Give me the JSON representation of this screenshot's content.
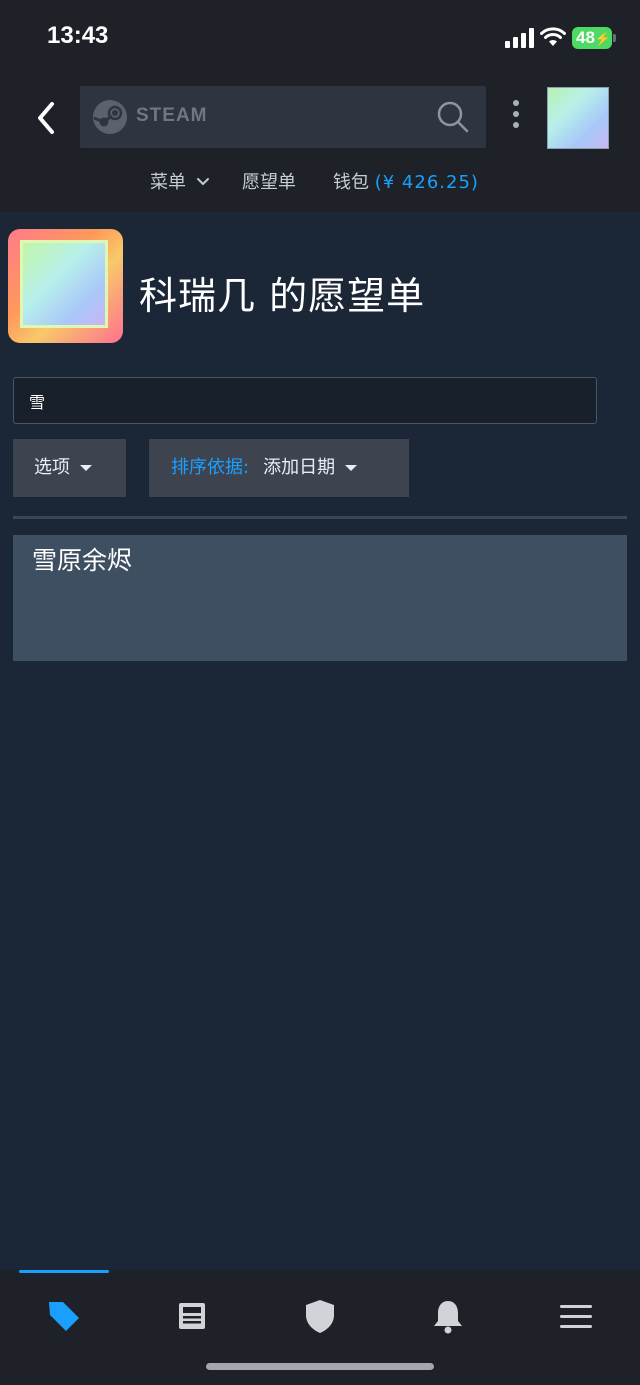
{
  "status_bar": {
    "time": "13:43",
    "battery": "48"
  },
  "header": {
    "search_logo_text": "STEAM",
    "back_icon": "chevron-left-icon",
    "search_icon": "search-icon",
    "more_icon": "kebab-menu-icon"
  },
  "subnav": {
    "menu_label": "菜单",
    "wishlist_label": "愿望单",
    "wallet_label": "钱包",
    "wallet_amount": "(¥ 426.25)"
  },
  "profile": {
    "title": "科瑞几 的愿望单"
  },
  "filter": {
    "value": "雪"
  },
  "controls": {
    "options_label": "选项",
    "sort_label": "排序依据:",
    "sort_value": "添加日期"
  },
  "wishlist": {
    "items": [
      {
        "title": "雪原余烬"
      }
    ]
  },
  "bottom_nav": {
    "tabs": [
      "store-tag-icon",
      "news-icon",
      "shield-icon",
      "bell-icon",
      "hamburger-menu-icon"
    ],
    "active_tab": "store-tag-icon"
  },
  "colors": {
    "background": "#1b2636",
    "bar": "#1e2228",
    "accent": "#1a9fff",
    "button": "#3d4450",
    "item": "#3f4f62"
  }
}
